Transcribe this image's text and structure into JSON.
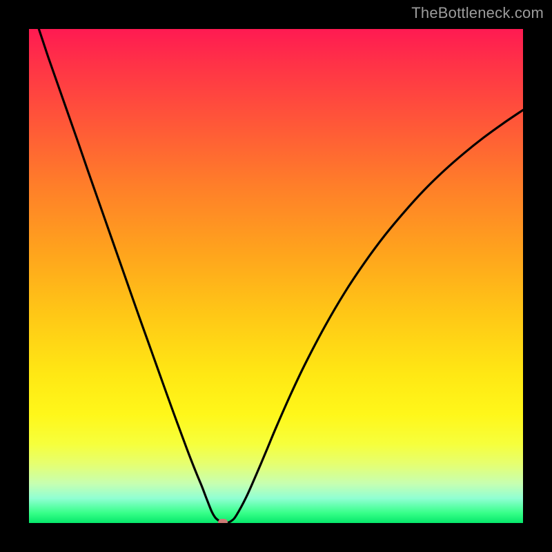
{
  "watermark": "TheBottleneck.com",
  "chart_data": {
    "type": "line",
    "title": "",
    "xlabel": "",
    "ylabel": "",
    "xlim": [
      0,
      100
    ],
    "ylim": [
      0,
      100
    ],
    "grid": false,
    "legend": false,
    "series": [
      {
        "name": "bottleneck-curve",
        "x": [
          0,
          1,
          2,
          3,
          4,
          6,
          8,
          10,
          12,
          14,
          16,
          18,
          20,
          22,
          24,
          26,
          28,
          30,
          32,
          33,
          34,
          35,
          35.8,
          36.5,
          37,
          37.5,
          38,
          39,
          40,
          41,
          42,
          44,
          46,
          48,
          50,
          53,
          56,
          60,
          64,
          68,
          72,
          76,
          80,
          84,
          88,
          92,
          96,
          100
        ],
        "y": [
          106,
          103,
          100,
          97,
          94,
          88.3,
          82.6,
          76.9,
          71.1,
          65.4,
          59.7,
          54.0,
          48.3,
          42.6,
          37.0,
          31.4,
          25.8,
          20.3,
          14.9,
          12.3,
          9.8,
          7.4,
          5.3,
          3.5,
          2.3,
          1.4,
          0.8,
          0.15,
          0.02,
          0.45,
          1.6,
          5.3,
          9.8,
          14.5,
          19.3,
          26.1,
          32.4,
          40.0,
          46.8,
          52.8,
          58.2,
          63.0,
          67.4,
          71.3,
          74.8,
          78.0,
          80.9,
          83.6
        ]
      }
    ],
    "marker": {
      "x": 39.3,
      "y": 0.1,
      "color": "#cc7a75"
    }
  }
}
